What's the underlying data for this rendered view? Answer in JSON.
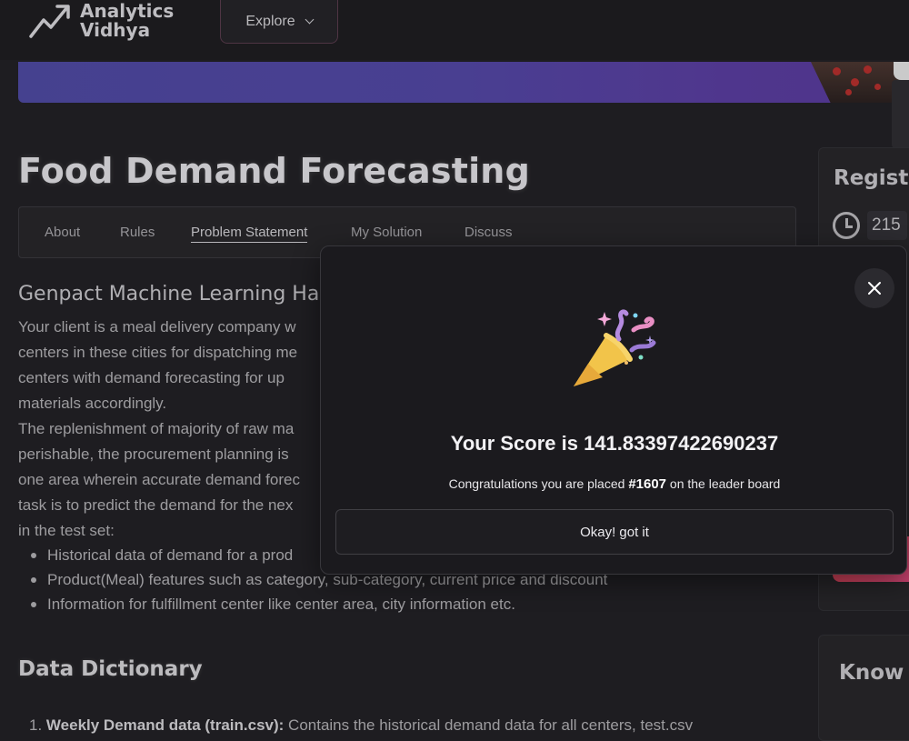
{
  "header": {
    "logo_line1": "Analytics",
    "logo_line2": "Vidhya",
    "explore_label": "Explore"
  },
  "page": {
    "title": "Food Demand Forecasting",
    "tabs": [
      {
        "label": "About"
      },
      {
        "label": "Rules"
      },
      {
        "label": "Problem Statement",
        "active": true
      },
      {
        "label": "My Solution"
      },
      {
        "label": "Discuss"
      }
    ],
    "section_title": "Genpact Machine Learning Hac",
    "paragraph_lines": [
      "Your client is a meal delivery company w",
      "centers in these cities for dispatching me",
      "centers with demand forecasting for up",
      "materials accordingly.",
      "The replenishment of majority of raw ma",
      "perishable, the procurement planning is",
      "one area wherein accurate demand forec",
      "task is to predict the demand for the nex",
      "in the test set:"
    ],
    "bullets": [
      "Historical data of demand for a prod",
      "Product(Meal) features such as category, sub-category, current price and discount",
      "Information for fulfillment center like center area, city information etc."
    ],
    "data_dictionary_title": "Data Dictionary",
    "dict_item_number": "1.",
    "dict_item_bold": "Weekly Demand data (train.csv):",
    "dict_item_text": " Contains the historical demand data for all centers, test.csv"
  },
  "sidebar": {
    "registration_title": "Registra",
    "registration_count": "215",
    "know_title": "Know w"
  },
  "modal": {
    "score_text": "Your Score is 141.83397422690237",
    "congrats_prefix": "Congratulations you are placed ",
    "rank": "#1607",
    "congrats_suffix": " on the leader board",
    "ok_label": "Okay! got it"
  },
  "icons": {
    "logo": "chart-trend-icon",
    "explore_chevron": "chevron-down-icon",
    "clock": "clock-icon",
    "close": "close-icon",
    "celebration": "party-popper-icon"
  }
}
